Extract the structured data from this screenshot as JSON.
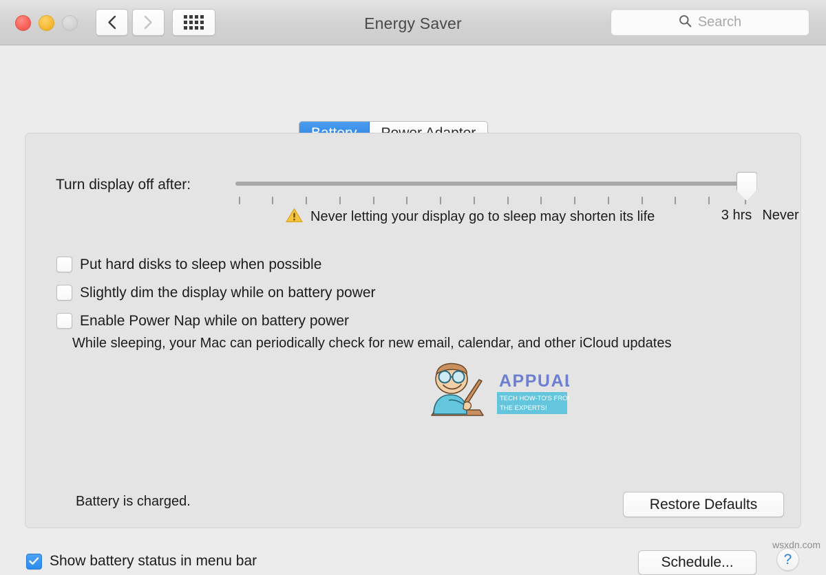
{
  "window": {
    "title": "Energy Saver",
    "traffic_lights": [
      "close",
      "minimize",
      "zoom"
    ],
    "nav": {
      "back": "back-chevron",
      "forward": "forward-chevron",
      "show_all": "grid-icon"
    },
    "search": {
      "placeholder": "Search",
      "value": "",
      "icon": "search-icon"
    }
  },
  "tabs": [
    {
      "label": "Battery",
      "active": true
    },
    {
      "label": "Power Adapter",
      "active": false
    }
  ],
  "slider": {
    "label": "Turn display off after:",
    "value_label": "Never",
    "left_end_label": "3 hrs",
    "right_end_label": "Never",
    "tick_count": 16,
    "knob_position_pct": 100,
    "warning": {
      "icon": "warning-triangle-icon",
      "text": "Never letting your display go to sleep may shorten its life"
    }
  },
  "checkboxes": [
    {
      "label": "Put hard disks to sleep when possible",
      "checked": false
    },
    {
      "label": "Slightly dim the display while on battery power",
      "checked": false
    },
    {
      "label": "Enable Power Nap while on battery power",
      "checked": false
    }
  ],
  "power_nap_description": "While sleeping, your Mac can periodically check for new email, calendar, and other iCloud updates",
  "footer": {
    "battery_status": "Battery is charged.",
    "restore_defaults_label": "Restore Defaults"
  },
  "bottom_bar": {
    "show_battery_status": {
      "label": "Show battery status in menu bar",
      "checked": true
    },
    "schedule_label": "Schedule...",
    "help_label": "?"
  },
  "watermarks": {
    "appuals": {
      "name": "APPUALS",
      "tagline_line1": "TECH HOW-TO'S FROM",
      "tagline_line2": "THE EXPERTS!"
    },
    "corner": "wsxdn.com"
  },
  "colors": {
    "accent_blue": "#2a8bef",
    "tab_active_blue": "#2a7fe0",
    "warning_yellow": "#f5c43b",
    "window_bg": "#ececec",
    "panel_bg": "#e4e4e4"
  }
}
